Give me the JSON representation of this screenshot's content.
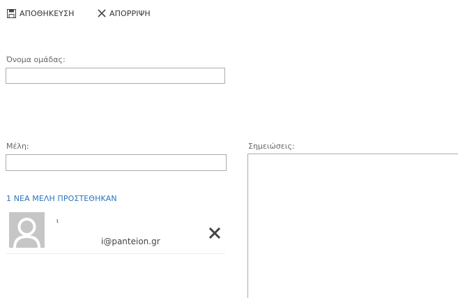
{
  "toolbar": {
    "save_label": "ΑΠΟΘΗΚΕΥΣΗ",
    "save_icon": "save-icon",
    "discard_label": "ΑΠΟΡΡΙΨΗ",
    "discard_icon": "close-icon"
  },
  "form": {
    "group_name_label": "Όνομα ομάδας:",
    "group_name_value": "",
    "members_label": "Μέλη:",
    "members_input_value": "",
    "notes_label": "Σημειώσεις:",
    "notes_value": ""
  },
  "members": {
    "added_heading": "1 ΝΕΑ ΜΕΛΗ ΠΡΟΣΤΕΘΗΚΑΝ",
    "list": [
      {
        "name": "ι",
        "email": "i@panteion.gr",
        "avatar_icon": "default-user-avatar-icon",
        "remove_icon": "close-icon"
      }
    ]
  },
  "colors": {
    "accent": "#2a73bb",
    "text": "#333333",
    "border": "#ababab",
    "avatar_bg": "#c6c6c6"
  }
}
